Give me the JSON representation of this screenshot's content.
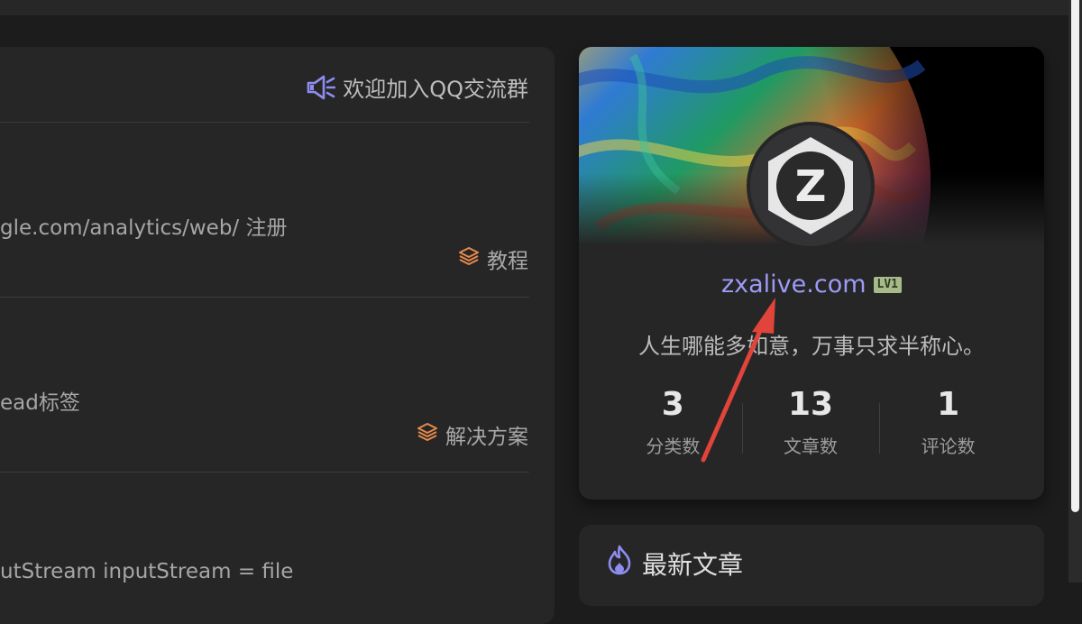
{
  "notice": {
    "text": "欢迎加入QQ交流群",
    "icon": "megaphone-icon"
  },
  "posts": [
    {
      "snippet": "gle.com/analytics/web/ 注册",
      "category": "教程",
      "icon": "layers-icon"
    },
    {
      "snippet": "ead标签",
      "category": "解决方案",
      "icon": "layers-icon"
    },
    {
      "snippet": "utStream inputStream = file"
    }
  ],
  "profile": {
    "avatar_letter": "Z",
    "site_name": "zxalive.com",
    "level": "LV1",
    "motto": "人生哪能多如意，万事只求半称心。",
    "stats": [
      {
        "value": "3",
        "label": "分类数"
      },
      {
        "value": "13",
        "label": "文章数"
      },
      {
        "value": "1",
        "label": "评论数"
      }
    ]
  },
  "latest": {
    "title": "最新文章",
    "icon": "flame-icon"
  },
  "colors": {
    "accent": "#8f8cf0",
    "background": "#1c1c1d",
    "card": "#262627",
    "category_icon": "#e8894a",
    "annotation_arrow": "#e0443a"
  }
}
